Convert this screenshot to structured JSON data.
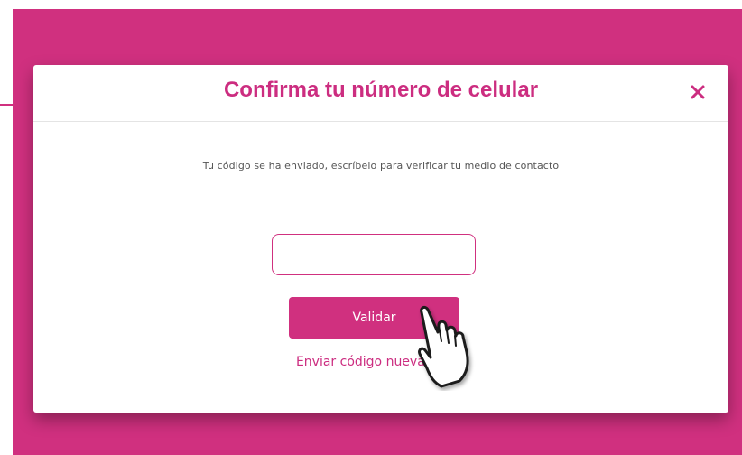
{
  "modal": {
    "title": "Confirma tu número de celular",
    "close_icon": "close-icon",
    "message": "Tu código se ha enviado, escríbelo para verificar tu medio de contacto",
    "code_input": {
      "value": "",
      "placeholder": ""
    },
    "validate_label": "Validar",
    "resend_label": "Enviar código nuevamente"
  },
  "cursor_icon": "hand-pointer-icon",
  "colors": {
    "brand": "#d0307f",
    "title": "#cc2d80",
    "text": "#555555"
  }
}
